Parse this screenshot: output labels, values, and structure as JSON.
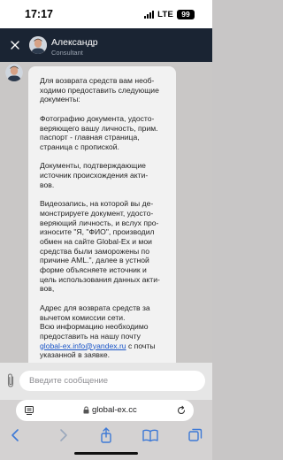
{
  "status_bar": {
    "time": "17:17",
    "network": "LTE",
    "battery": "99"
  },
  "header": {
    "agent_name": "Александр",
    "agent_role": "Consultant"
  },
  "message": {
    "paragraphs": [
      "Для  возврата средств вам необ-\nходимо предоставить следующие\nдокументы:",
      "Фотографию документа, удосто-\nверяющего вашу личность, прим.\nпаспорт - главная страница,\nстраница с пропиской.",
      "Документы, подтверждающие\nисточник происхождения акти-\nвов.",
      "Видеозапись, на которой вы де-\nмонстрируете документ, удосто-\nверяющий личность, и вслух про-\nизносите \"Я, \"ФИО\", производил\nобмен на сайте Global-Ex и мои\nсредства были заморожены по\nпричине AML.\", далее в устной\nформе объясняете источник и\nцель использования данных акти-\nвов,",
      "Адрес для возврата средств за\nвычетом комиссии сети."
    ],
    "closing_before": "Всю информацию необходимо\nпредоставить на нашу почту\n",
    "email": "global-ex.info@yandex.ru",
    "closing_after": " с почты\nуказанной в заявке."
  },
  "composer": {
    "placeholder": "Введите сообщение"
  },
  "browser": {
    "url": "global-ex.cc"
  }
}
